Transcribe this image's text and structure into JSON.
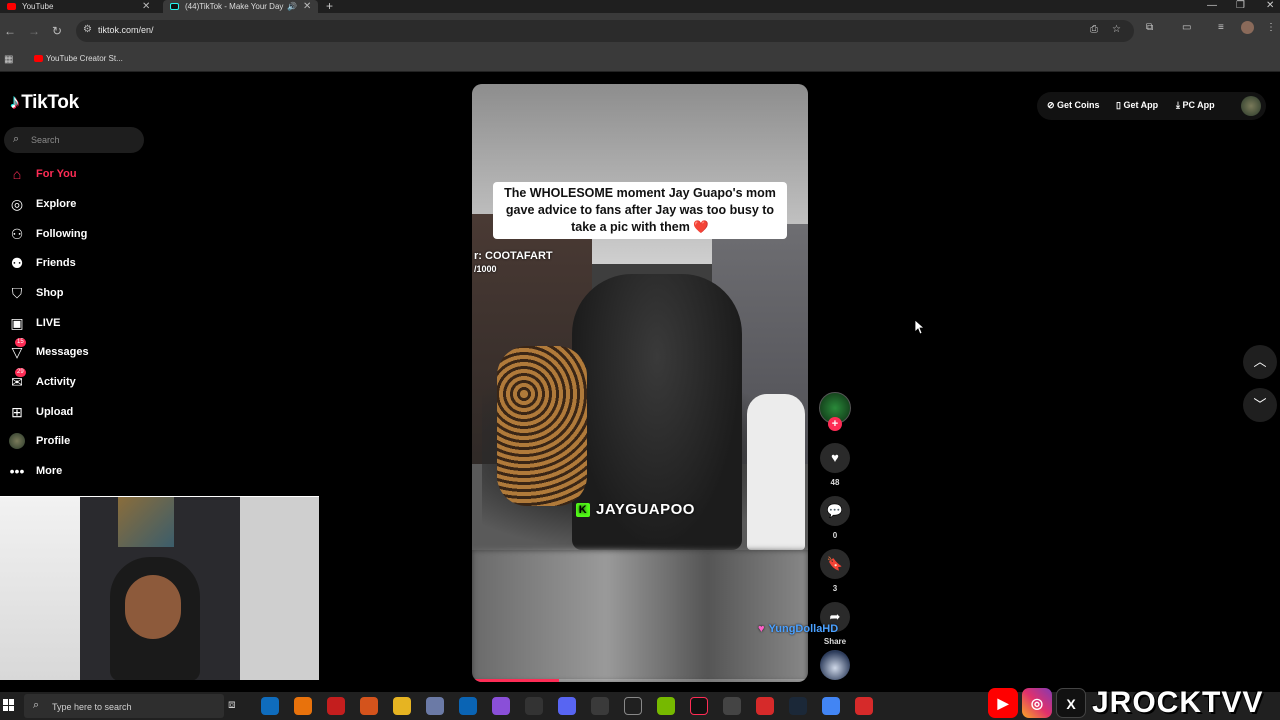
{
  "browser": {
    "tabs": [
      {
        "title": "YouTube"
      },
      {
        "title": "(44)TikTok - Make Your Day"
      }
    ],
    "url": "tiktok.com/en/",
    "bookmark": "YouTube Creator St..."
  },
  "tiktok": {
    "logo": "TikTok",
    "search_placeholder": "Search",
    "nav": [
      {
        "label": "For You",
        "icon": "home-icon"
      },
      {
        "label": "Explore",
        "icon": "compass-icon"
      },
      {
        "label": "Following",
        "icon": "person-follow-icon"
      },
      {
        "label": "Friends",
        "icon": "friends-icon"
      },
      {
        "label": "Shop",
        "icon": "shop-bag-icon"
      },
      {
        "label": "LIVE",
        "icon": "live-tv-icon"
      },
      {
        "label": "Messages",
        "icon": "send-icon",
        "badge": "15"
      },
      {
        "label": "Activity",
        "icon": "inbox-icon",
        "badge": "29"
      },
      {
        "label": "Upload",
        "icon": "plus-square-icon"
      },
      {
        "label": "Profile",
        "icon": "avatar-icon"
      },
      {
        "label": "More",
        "icon": "more-dots-icon"
      }
    ],
    "top_right": {
      "get_coins": "Get Coins",
      "get_app": "Get App",
      "pc_app": "PC App"
    },
    "video": {
      "caption": "The WHOLESOME moment Jay Guapo's mom gave advice to fans after Jay was too busy to take a pic with them ❤️",
      "credit_line1": "r: COOTAFART",
      "credit_line2": "/1000",
      "watermark": "JAYGUAPOO",
      "progress": 0.26
    },
    "actions": {
      "likes": "48",
      "comments": "0",
      "saves": "3",
      "share": "Share"
    }
  },
  "overlay": {
    "chat_user": "YungDollaHD",
    "brand": "JROCKTVV"
  },
  "taskbar": {
    "search_placeholder": "Type here to search"
  },
  "colors": {
    "tiktok_red": "#fe2c55",
    "browser_bg": "#3a3a3a"
  }
}
